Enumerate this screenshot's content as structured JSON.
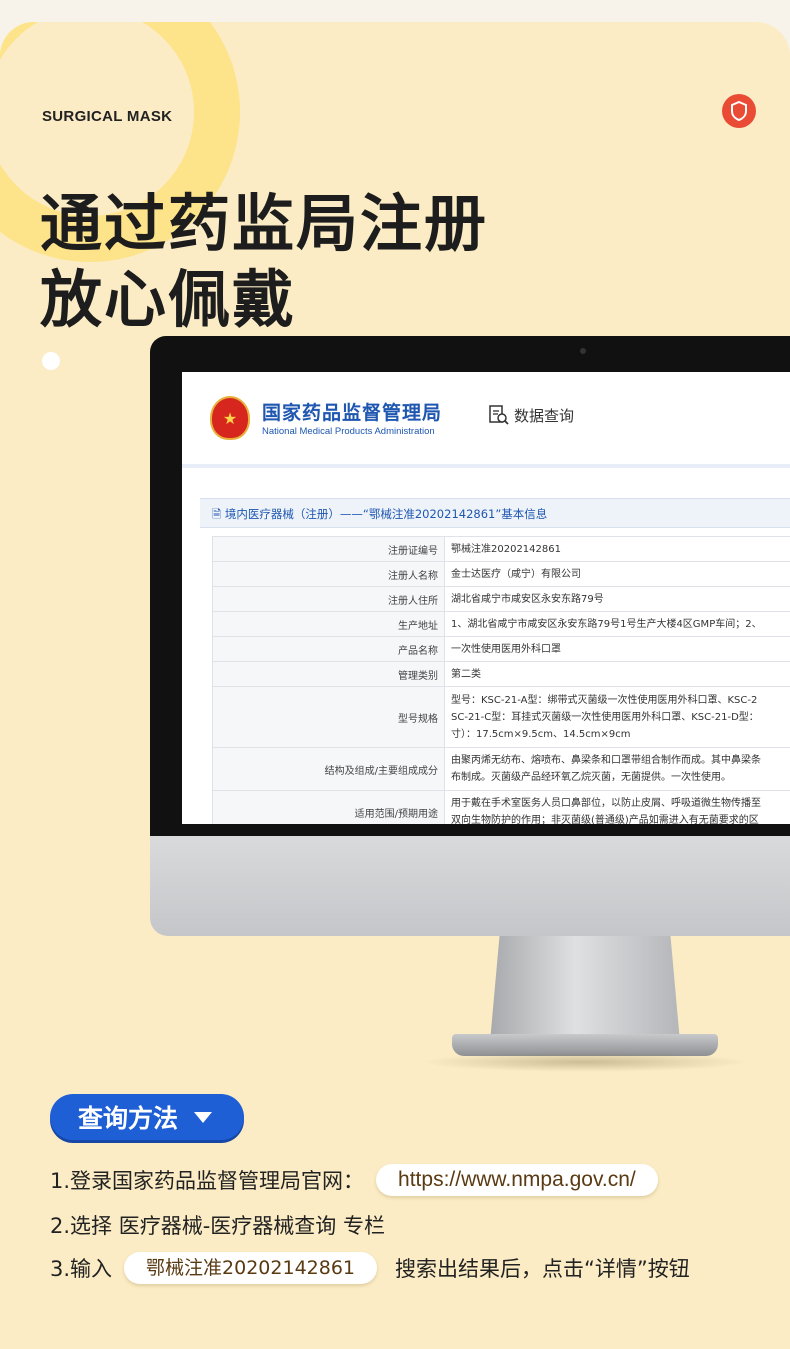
{
  "kicker": "SURGICAL MASK",
  "headline": {
    "line1": "通过药监局注册",
    "line2": "放心佩戴"
  },
  "site": {
    "name_cn": "国家药品监督管理局",
    "name_en": "National Medical Products Administration",
    "data_query": "数据查询",
    "panel_title": "境内医疗器械（注册）——“鄂械注准20202142861”基本信息"
  },
  "table": [
    {
      "label": "注册证编号",
      "value": [
        "鄂械注准20202142861"
      ]
    },
    {
      "label": "注册人名称",
      "value": [
        "金士达医疗（咸宁）有限公司"
      ]
    },
    {
      "label": "注册人住所",
      "value": [
        "湖北省咸宁市咸安区永安东路79号"
      ]
    },
    {
      "label": "生产地址",
      "value": [
        "1、湖北省咸宁市咸安区永安东路79号1号生产大楼4区GMP车间；2、"
      ]
    },
    {
      "label": "产品名称",
      "value": [
        "一次性使用医用外科口罩"
      ]
    },
    {
      "label": "管理类别",
      "value": [
        "第二类"
      ]
    },
    {
      "label": "型号规格",
      "value": [
        "型号：KSC-21-A型：绑带式灭菌级一次性使用医用外科口罩、KSC-2",
        "SC-21-C型：耳挂式灭菌级一次性使用医用外科口罩、KSC-21-D型：",
        "寸）：17.5cm×9.5cm、14.5cm×9cm"
      ]
    },
    {
      "label": "结构及组成/主要组成成分",
      "value": [
        "由聚丙烯无纺布、熔喷布、鼻梁条和口罩带组合制作而成。其中鼻梁条",
        "布制成。灭菌级产品经环氧乙烷灭菌，无菌提供。一次性使用。"
      ]
    },
    {
      "label": "适用范围/预期用途",
      "value": [
        "用于戴在手术室医务人员口鼻部位，以防止皮屑、呼吸道微生物传播至",
        "双向生物防护的作用；非灭菌级(普通级)产品如需进入有无菌要求的区"
      ]
    }
  ],
  "method": {
    "title": "查询方法",
    "step1_prefix": "1.登录国家药品监督管理局官网：",
    "step1_url": "https://www.nmpa.gov.cn/",
    "step2": "2.选择 医疗器械-医疗器械查询 专栏",
    "step3_prefix": "3.输入",
    "step3_code": "鄂械注准20202142861",
    "step3_suffix": "搜索出结果后，点击“详情”按钮"
  },
  "colors": {
    "accent": "#1f5fd6",
    "badge": "#e94b35",
    "background": "#fbecc5"
  }
}
